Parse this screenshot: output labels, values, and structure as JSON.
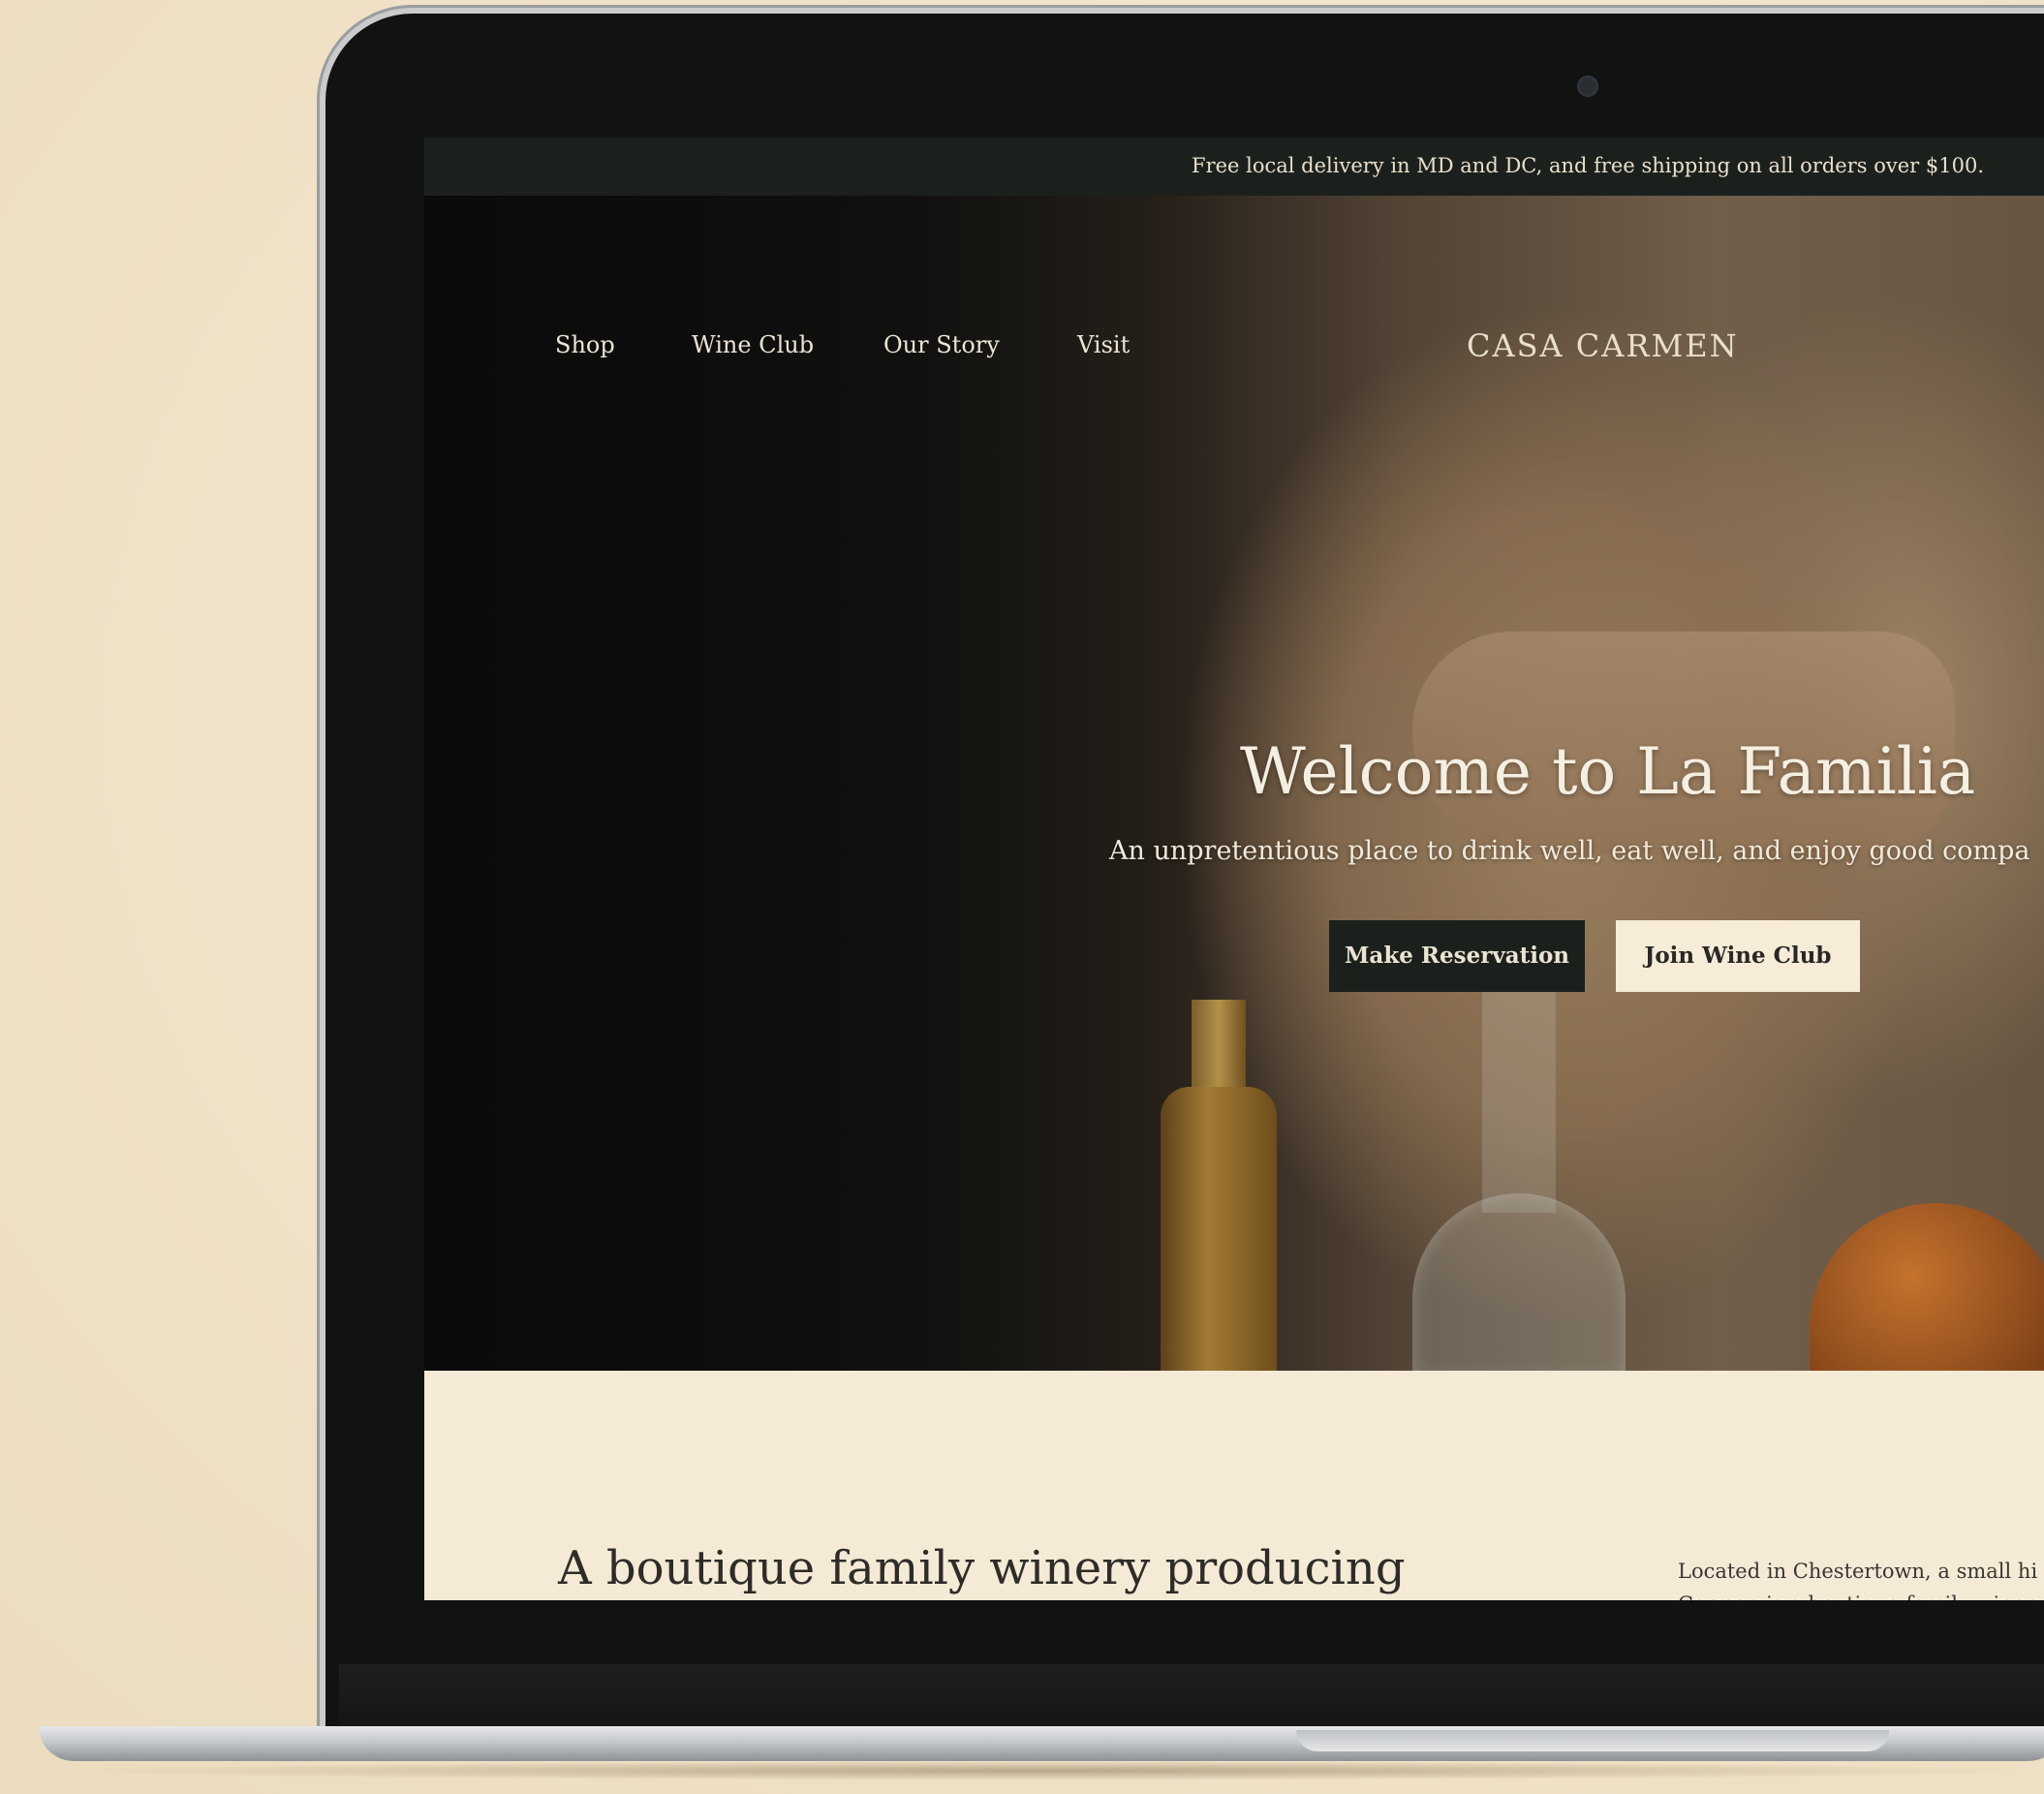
{
  "announcement": {
    "text": "Free local delivery in MD and DC, and free shipping on all orders over $100."
  },
  "nav": {
    "links": [
      "Shop",
      "Wine Club",
      "Our Story",
      "Visit"
    ],
    "logo": "CASA CARMEN"
  },
  "hero": {
    "title": "Welcome to La Familia",
    "subtitle": "An unpretentious place to drink well, eat well, and enjoy good compa",
    "primary_button": "Make Reservation",
    "secondary_button": "Join Wine Club"
  },
  "intro": {
    "heading": "A boutique family winery producing",
    "text_line1": "Located in Chestertown, a small hi",
    "text_line2": "Carmen is a boutique family winery"
  },
  "colors": {
    "page_background": "#f2e6cf",
    "announcement_bar": "#1c201d",
    "primary_button": "#1b201c",
    "secondary_button": "#f6ecd8",
    "section_background": "#f5ead6"
  }
}
